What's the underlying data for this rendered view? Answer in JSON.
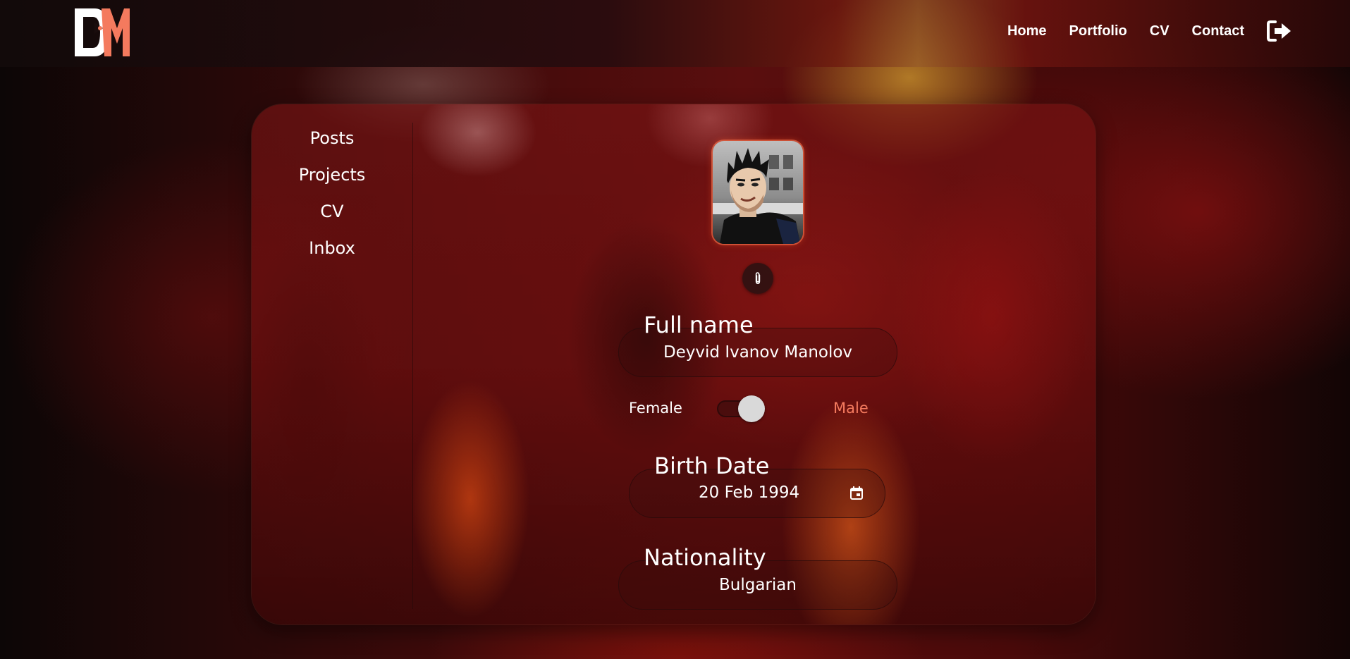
{
  "nav": {
    "logo_text": "DM",
    "links": [
      {
        "label": "Home"
      },
      {
        "label": "Portfolio"
      },
      {
        "label": "CV"
      },
      {
        "label": "Contact"
      }
    ],
    "logout_icon": "sign-out-icon"
  },
  "sidebar": {
    "items": [
      {
        "label": "Posts"
      },
      {
        "label": "Projects"
      },
      {
        "label": "CV"
      },
      {
        "label": "Inbox"
      }
    ]
  },
  "profile": {
    "avatar_icon": "user-avatar",
    "attach_icon": "paperclip-icon",
    "full_name": {
      "label": "Full name",
      "value": "Deyvid Ivanov Manolov"
    },
    "gender": {
      "left_label": "Female",
      "right_label": "Male",
      "selected": "Male",
      "selected_color": "#f47a5e"
    },
    "birth_date": {
      "label": "Birth Date",
      "value": "20 Feb 1994",
      "icon": "calendar-icon"
    },
    "nationality": {
      "label": "Nationality",
      "value": "Bulgarian"
    }
  },
  "colors": {
    "accent": "#f47a5e",
    "navbar": "#1a0d0d"
  }
}
